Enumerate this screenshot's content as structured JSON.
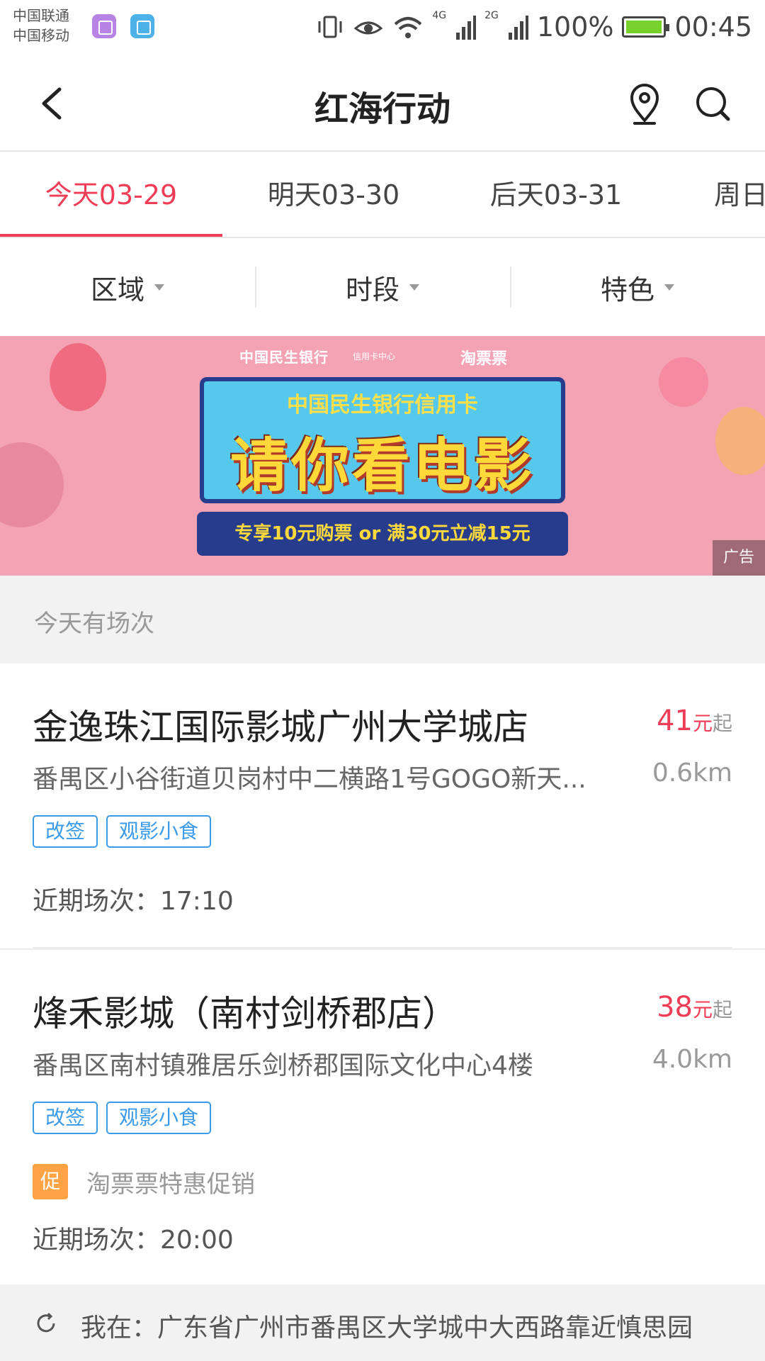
{
  "status_bar": {
    "carrier_1": "中国联通",
    "carrier_2": "中国移动",
    "net_1": "4G",
    "net_2": "2G",
    "battery": "100%",
    "time": "00:45"
  },
  "header": {
    "title": "红海行动",
    "icons": [
      "back-arrow-icon",
      "location-pin-icon",
      "search-icon"
    ]
  },
  "date_tabs": [
    {
      "label": "今天03-29",
      "active": true
    },
    {
      "label": "明天03-30",
      "active": false
    },
    {
      "label": "后天03-31",
      "active": false
    },
    {
      "label": "周日",
      "active": false
    }
  ],
  "filters": [
    {
      "label": "区域"
    },
    {
      "label": "时段"
    },
    {
      "label": "特色"
    }
  ],
  "banner": {
    "bank_logo": "中国民生银行",
    "bank_logo_sub": "信用卡中心",
    "partner": "淘票票",
    "subtitle": "中国民生银行信用卡",
    "headline": "请你看电影",
    "offer": "专享10元购票 or 满30元立减15元",
    "ad_label": "广告"
  },
  "section": {
    "title": "今天有场次"
  },
  "cinemas": [
    {
      "name": "金逸珠江国际影城广州大学城店",
      "price": "41",
      "price_unit": "元",
      "price_suffix": "起",
      "address": "番禺区小谷街道贝岗村中二横路1号GOGO新天...",
      "distance": "0.6km",
      "tags": [
        "改签",
        "观影小食"
      ],
      "showtime": "近期场次：17:10"
    },
    {
      "name": "烽禾影城（南村剑桥郡店）",
      "price": "38",
      "price_unit": "元",
      "price_suffix": "起",
      "address": "番禺区南村镇雅居乐剑桥郡国际文化中心4楼",
      "distance": "4.0km",
      "tags": [
        "改签",
        "观影小食"
      ],
      "promo_badge": "促",
      "promo": "淘票票特惠促销",
      "showtime": "近期场次：20:00"
    }
  ],
  "location_bar": {
    "text": "我在：广东省广州市番禺区大学城中大西路靠近慎思园"
  },
  "colors": {
    "accent": "#f03d57",
    "tag_blue": "#3b9be8",
    "promo_orange": "#ffa345",
    "banner_pink": "#f4a3b5"
  }
}
